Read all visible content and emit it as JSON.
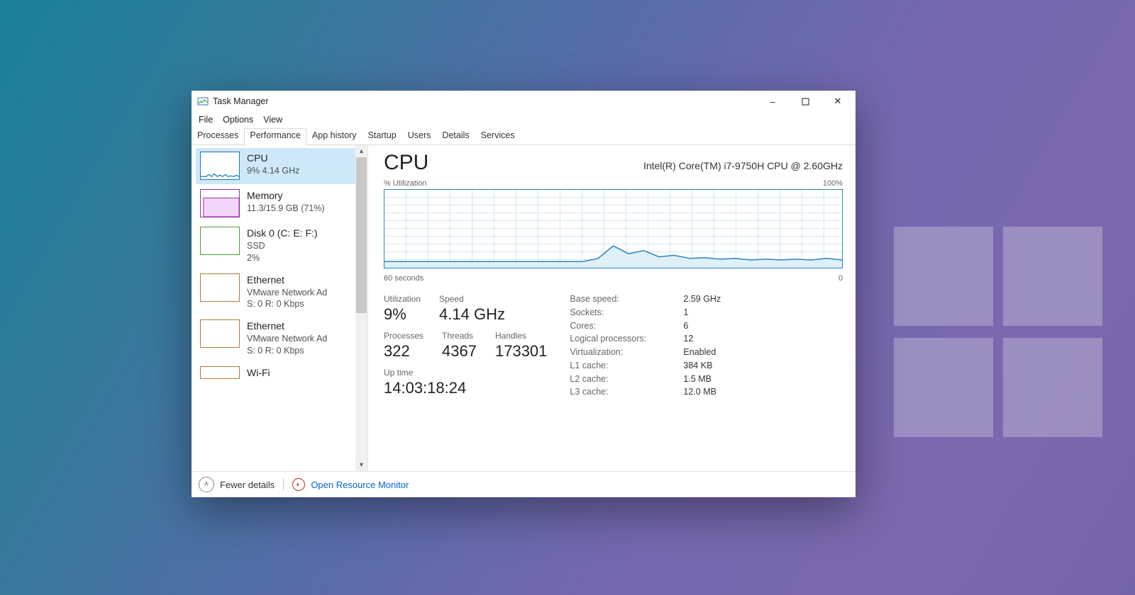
{
  "window": {
    "title": "Task Manager",
    "menus": [
      "File",
      "Options",
      "View"
    ],
    "tabs": [
      "Processes",
      "Performance",
      "App history",
      "Startup",
      "Users",
      "Details",
      "Services"
    ],
    "active_tab": "Performance"
  },
  "sidebar": {
    "items": [
      {
        "title": "CPU",
        "detail": "9%  4.14 GHz",
        "selected": true,
        "kind": "cpu"
      },
      {
        "title": "Memory",
        "detail": "11.3/15.9 GB (71%)",
        "kind": "mem"
      },
      {
        "title": "Disk 0 (C: E: F:)",
        "detail": "SSD",
        "detail2": "2%",
        "kind": "disk"
      },
      {
        "title": "Ethernet",
        "detail": "VMware Network Ad",
        "detail2": "S: 0 R: 0 Kbps",
        "kind": "eth"
      },
      {
        "title": "Ethernet",
        "detail": "VMware Network Ad",
        "detail2": "S: 0 R: 0 Kbps",
        "kind": "eth"
      },
      {
        "title": "Wi-Fi",
        "detail": "",
        "kind": "wifi"
      }
    ]
  },
  "main": {
    "heading": "CPU",
    "model": "Intel(R) Core(TM) i7-9750H CPU @ 2.60GHz",
    "graph": {
      "y_label": "% Utilization",
      "y_max": "100%",
      "x_label": "60 seconds",
      "x_right": "0"
    },
    "stats1": [
      {
        "label": "Utilization",
        "value": "9%"
      },
      {
        "label": "Speed",
        "value": "4.14 GHz"
      }
    ],
    "stats2": [
      {
        "label": "Processes",
        "value": "322"
      },
      {
        "label": "Threads",
        "value": "4367"
      },
      {
        "label": "Handles",
        "value": "173301"
      }
    ],
    "uptime": {
      "label": "Up time",
      "value": "14:03:18:24"
    },
    "kv": [
      {
        "k": "Base speed:",
        "v": "2.59 GHz"
      },
      {
        "k": "Sockets:",
        "v": "1"
      },
      {
        "k": "Cores:",
        "v": "6"
      },
      {
        "k": "Logical processors:",
        "v": "12"
      },
      {
        "k": "Virtualization:",
        "v": "Enabled"
      },
      {
        "k": "L1 cache:",
        "v": "384 KB"
      },
      {
        "k": "L2 cache:",
        "v": "1.5 MB"
      },
      {
        "k": "L3 cache:",
        "v": "12.0 MB"
      }
    ]
  },
  "footer": {
    "details_toggle": "Fewer details",
    "resource_monitor": "Open Resource Monitor"
  },
  "chart_data": {
    "type": "line",
    "title": "% Utilization",
    "xlabel": "60 seconds",
    "ylabel": "% Utilization",
    "xlim": [
      0,
      60
    ],
    "ylim": [
      0,
      100
    ],
    "x": [
      0,
      2,
      4,
      6,
      8,
      10,
      12,
      14,
      16,
      18,
      20,
      22,
      24,
      26,
      28,
      30,
      32,
      34,
      36,
      38,
      40,
      42,
      44,
      46,
      48,
      50,
      52,
      54,
      56,
      58,
      60
    ],
    "values": [
      8,
      8,
      8,
      8,
      8,
      8,
      8,
      8,
      8,
      8,
      8,
      8,
      8,
      8,
      12,
      28,
      18,
      22,
      14,
      16,
      12,
      13,
      11,
      12,
      10,
      11,
      10,
      11,
      10,
      12,
      10
    ]
  }
}
